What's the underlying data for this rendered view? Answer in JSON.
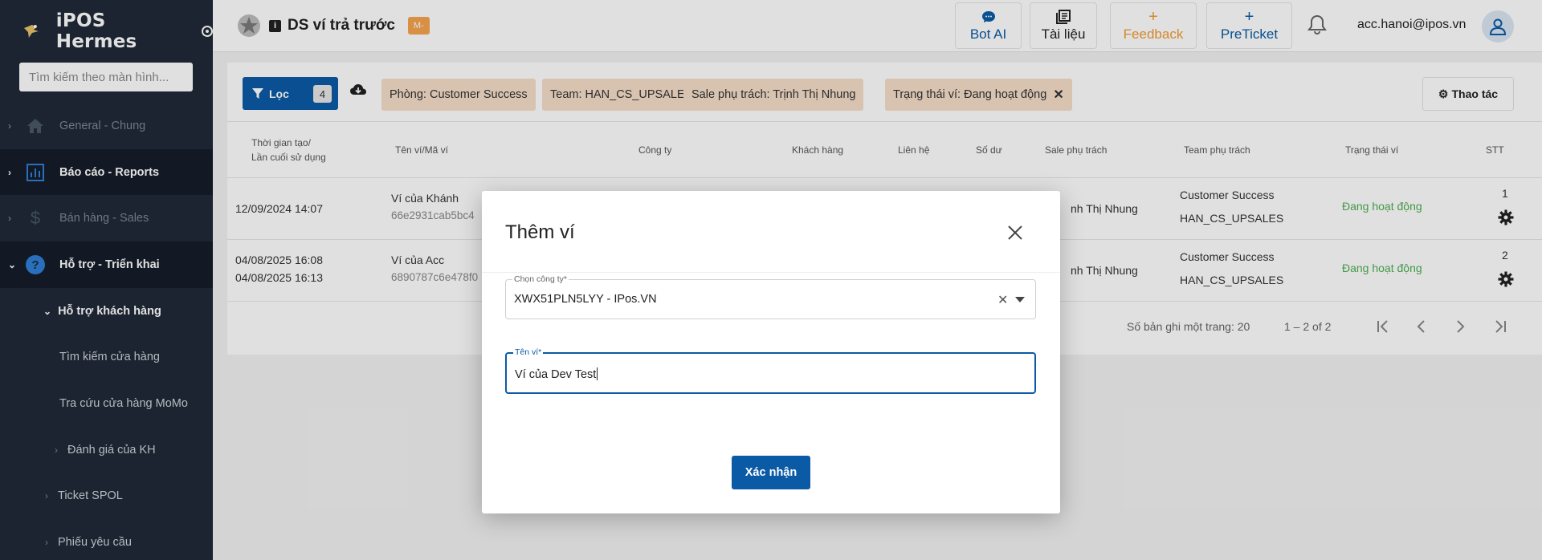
{
  "sidebar": {
    "app_title": "iPOS Hermes",
    "search_placeholder": "Tìm kiếm theo màn hình...",
    "items": [
      {
        "label": "General - Chung"
      },
      {
        "label": "Báo cáo - Reports"
      },
      {
        "label": "Bán hàng - Sales"
      },
      {
        "label": "Hỗ trợ - Triển khai"
      },
      {
        "label": "Hỗ trợ khách hàng"
      },
      {
        "label": "Tìm kiếm cửa hàng"
      },
      {
        "label": "Tra cứu cửa hàng MoMo"
      },
      {
        "label": "Đánh giá của KH"
      },
      {
        "label": "Ticket SPOL"
      },
      {
        "label": "Phiếu yêu cầu"
      }
    ]
  },
  "header": {
    "page_title": "DS ví trả trước",
    "badge": "M-",
    "buttons": {
      "bot_ai": "Bot AI",
      "docs": "Tài liệu",
      "feedback": "Feedback",
      "preticket": "PreTicket"
    },
    "user_email": "acc.hanoi@ipos.vn"
  },
  "filters": {
    "filter_label": "Lọc",
    "filter_count": "4",
    "chips": [
      "Phòng: Customer Success",
      "Team: HAN_CS_UPSALES",
      "Sale phụ trách: Trịnh Thị Nhung",
      "Trạng thái ví: Đang hoạt động"
    ],
    "actions_label": "Thao tác"
  },
  "table": {
    "headers": {
      "created_line1": "Thời gian tạo/",
      "created_line2": "Lần cuối sử dụng",
      "wallet": "Tên ví/Mã ví",
      "company": "Công ty",
      "customer": "Khách hàng",
      "contact": "Liên hệ",
      "balance": "Số dư",
      "sale": "Sale phụ trách",
      "team": "Team phụ trách",
      "status": "Trạng thái ví",
      "stt": "STT"
    },
    "rows": [
      {
        "created": "12/09/2024 14:07",
        "last_used": "",
        "wallet_name": "Ví của Khánh",
        "wallet_code": "66e2931cab5bc4",
        "sale": "nh Thị Nhung",
        "team1": "Customer Success",
        "team2": "HAN_CS_UPSALES",
        "status": "Đang hoạt động",
        "stt": "1"
      },
      {
        "created": "04/08/2025 16:08",
        "last_used": "04/08/2025 16:13",
        "wallet_name": "Ví của Acc",
        "wallet_code": "6890787c6e478f0",
        "sale": "nh Thị Nhung",
        "team1": "Customer Success",
        "team2": "HAN_CS_UPSALES",
        "status": "Đang hoạt động",
        "stt": "2"
      }
    ],
    "pager": {
      "per_page": "Số bản ghi một trang: 20",
      "range": "1 – 2 of 2"
    }
  },
  "modal": {
    "title": "Thêm ví",
    "company_label": "Chọn công ty*",
    "company_value": "XWX51PLN5LYY - IPos.VN",
    "wallet_label": "Tên ví*",
    "wallet_value": "Ví của Dev Test",
    "confirm": "Xác nhận"
  }
}
